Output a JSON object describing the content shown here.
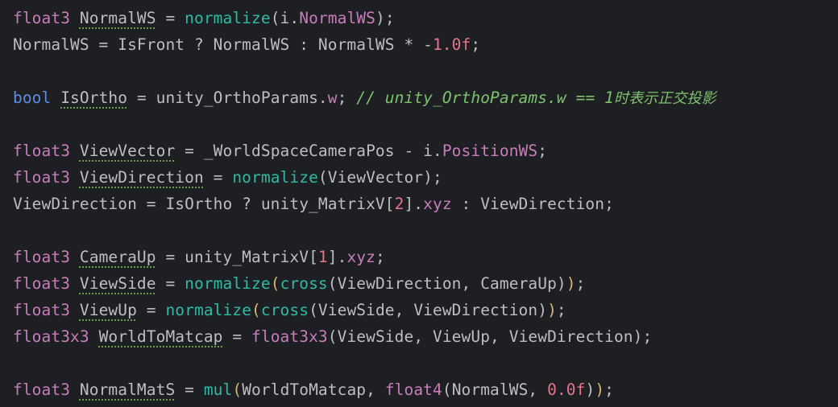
{
  "lines": [
    {
      "tokens": [
        {
          "text": "float3",
          "cls": "t-type"
        },
        {
          "text": " ",
          "cls": "t-ident"
        },
        {
          "text": "NormalWS",
          "cls": "t-ident",
          "typo": true
        },
        {
          "text": " = ",
          "cls": "t-ident"
        },
        {
          "text": "normalize",
          "cls": "t-func"
        },
        {
          "text": "(i.",
          "cls": "t-ident"
        },
        {
          "text": "NormalWS",
          "cls": "t-field"
        },
        {
          "text": ");",
          "cls": "t-ident"
        }
      ]
    },
    {
      "tokens": [
        {
          "text": "NormalWS = IsFront ? NormalWS : NormalWS * -",
          "cls": "t-ident"
        },
        {
          "text": "1.0f",
          "cls": "t-num"
        },
        {
          "text": ";",
          "cls": "t-ident"
        }
      ]
    },
    {
      "tokens": []
    },
    {
      "tokens": [
        {
          "text": "bool",
          "cls": "t-kw"
        },
        {
          "text": " ",
          "cls": "t-ident"
        },
        {
          "text": "IsOrtho",
          "cls": "t-ident",
          "typo": true
        },
        {
          "text": " = unity_OrthoParams.",
          "cls": "t-ident"
        },
        {
          "text": "w",
          "cls": "t-field"
        },
        {
          "text": "; ",
          "cls": "t-ident"
        },
        {
          "text": "// unity_OrthoParams.w == 1",
          "cls": "t-comment"
        },
        {
          "text": "时表示正交投影",
          "cls": "t-cjk"
        }
      ]
    },
    {
      "tokens": []
    },
    {
      "tokens": [
        {
          "text": "float3",
          "cls": "t-type"
        },
        {
          "text": " ",
          "cls": "t-ident"
        },
        {
          "text": "ViewVector",
          "cls": "t-ident",
          "typo": true
        },
        {
          "text": " = _WorldSpaceCameraPos - i.",
          "cls": "t-ident"
        },
        {
          "text": "PositionWS",
          "cls": "t-field"
        },
        {
          "text": ";",
          "cls": "t-ident"
        }
      ]
    },
    {
      "tokens": [
        {
          "text": "float3",
          "cls": "t-type"
        },
        {
          "text": " ",
          "cls": "t-ident"
        },
        {
          "text": "ViewDirection",
          "cls": "t-ident",
          "typo": true
        },
        {
          "text": " = ",
          "cls": "t-ident"
        },
        {
          "text": "normalize",
          "cls": "t-func"
        },
        {
          "text": "(ViewVector);",
          "cls": "t-ident"
        }
      ]
    },
    {
      "tokens": [
        {
          "text": "ViewDirection = IsOrtho ? unity_MatrixV[",
          "cls": "t-ident"
        },
        {
          "text": "2",
          "cls": "t-num"
        },
        {
          "text": "].",
          "cls": "t-ident"
        },
        {
          "text": "xyz",
          "cls": "t-field"
        },
        {
          "text": " : ViewDirection;",
          "cls": "t-ident"
        }
      ]
    },
    {
      "tokens": []
    },
    {
      "tokens": [
        {
          "text": "float3",
          "cls": "t-type"
        },
        {
          "text": " ",
          "cls": "t-ident"
        },
        {
          "text": "CameraUp",
          "cls": "t-ident",
          "typo": true
        },
        {
          "text": " = unity_MatrixV[",
          "cls": "t-ident"
        },
        {
          "text": "1",
          "cls": "t-num"
        },
        {
          "text": "].",
          "cls": "t-ident"
        },
        {
          "text": "xyz",
          "cls": "t-field"
        },
        {
          "text": ";",
          "cls": "t-ident"
        }
      ]
    },
    {
      "tokens": [
        {
          "text": "float3",
          "cls": "t-type"
        },
        {
          "text": " ",
          "cls": "t-ident"
        },
        {
          "text": "ViewSide",
          "cls": "t-ident",
          "typo": true
        },
        {
          "text": " = ",
          "cls": "t-ident"
        },
        {
          "text": "normalize",
          "cls": "t-func"
        },
        {
          "text": "(",
          "cls": "t-paren-a"
        },
        {
          "text": "cross",
          "cls": "t-func"
        },
        {
          "text": "(ViewDirection, CameraUp)",
          "cls": "t-ident"
        },
        {
          "text": ")",
          "cls": "t-paren-a"
        },
        {
          "text": ";",
          "cls": "t-ident"
        }
      ]
    },
    {
      "tokens": [
        {
          "text": "float3",
          "cls": "t-type"
        },
        {
          "text": " ",
          "cls": "t-ident"
        },
        {
          "text": "ViewUp",
          "cls": "t-ident",
          "typo": true
        },
        {
          "text": " = ",
          "cls": "t-ident"
        },
        {
          "text": "normalize",
          "cls": "t-func"
        },
        {
          "text": "(",
          "cls": "t-paren-a"
        },
        {
          "text": "cross",
          "cls": "t-func"
        },
        {
          "text": "(ViewSide, ViewDirection)",
          "cls": "t-ident"
        },
        {
          "text": ")",
          "cls": "t-paren-a"
        },
        {
          "text": ";",
          "cls": "t-ident"
        }
      ]
    },
    {
      "tokens": [
        {
          "text": "float3x3",
          "cls": "t-type"
        },
        {
          "text": " ",
          "cls": "t-ident"
        },
        {
          "text": "WorldToMatcap",
          "cls": "t-ident",
          "typo": true
        },
        {
          "text": " = ",
          "cls": "t-ident"
        },
        {
          "text": "float3x3",
          "cls": "t-type"
        },
        {
          "text": "(ViewSide, ViewUp, ViewDirection);",
          "cls": "t-ident"
        }
      ]
    },
    {
      "tokens": []
    },
    {
      "tokens": [
        {
          "text": "float3",
          "cls": "t-type"
        },
        {
          "text": " ",
          "cls": "t-ident"
        },
        {
          "text": "NormalMatS",
          "cls": "t-ident",
          "typo": true
        },
        {
          "text": " = ",
          "cls": "t-ident"
        },
        {
          "text": "mul",
          "cls": "t-func"
        },
        {
          "text": "(",
          "cls": "t-paren-a"
        },
        {
          "text": "WorldToMatcap, ",
          "cls": "t-ident"
        },
        {
          "text": "float4",
          "cls": "t-type"
        },
        {
          "text": "(NormalWS, ",
          "cls": "t-ident"
        },
        {
          "text": "0.0f",
          "cls": "t-num"
        },
        {
          "text": ")",
          "cls": "t-ident"
        },
        {
          "text": ")",
          "cls": "t-paren-a"
        },
        {
          "text": ";",
          "cls": "t-ident"
        }
      ]
    }
  ]
}
